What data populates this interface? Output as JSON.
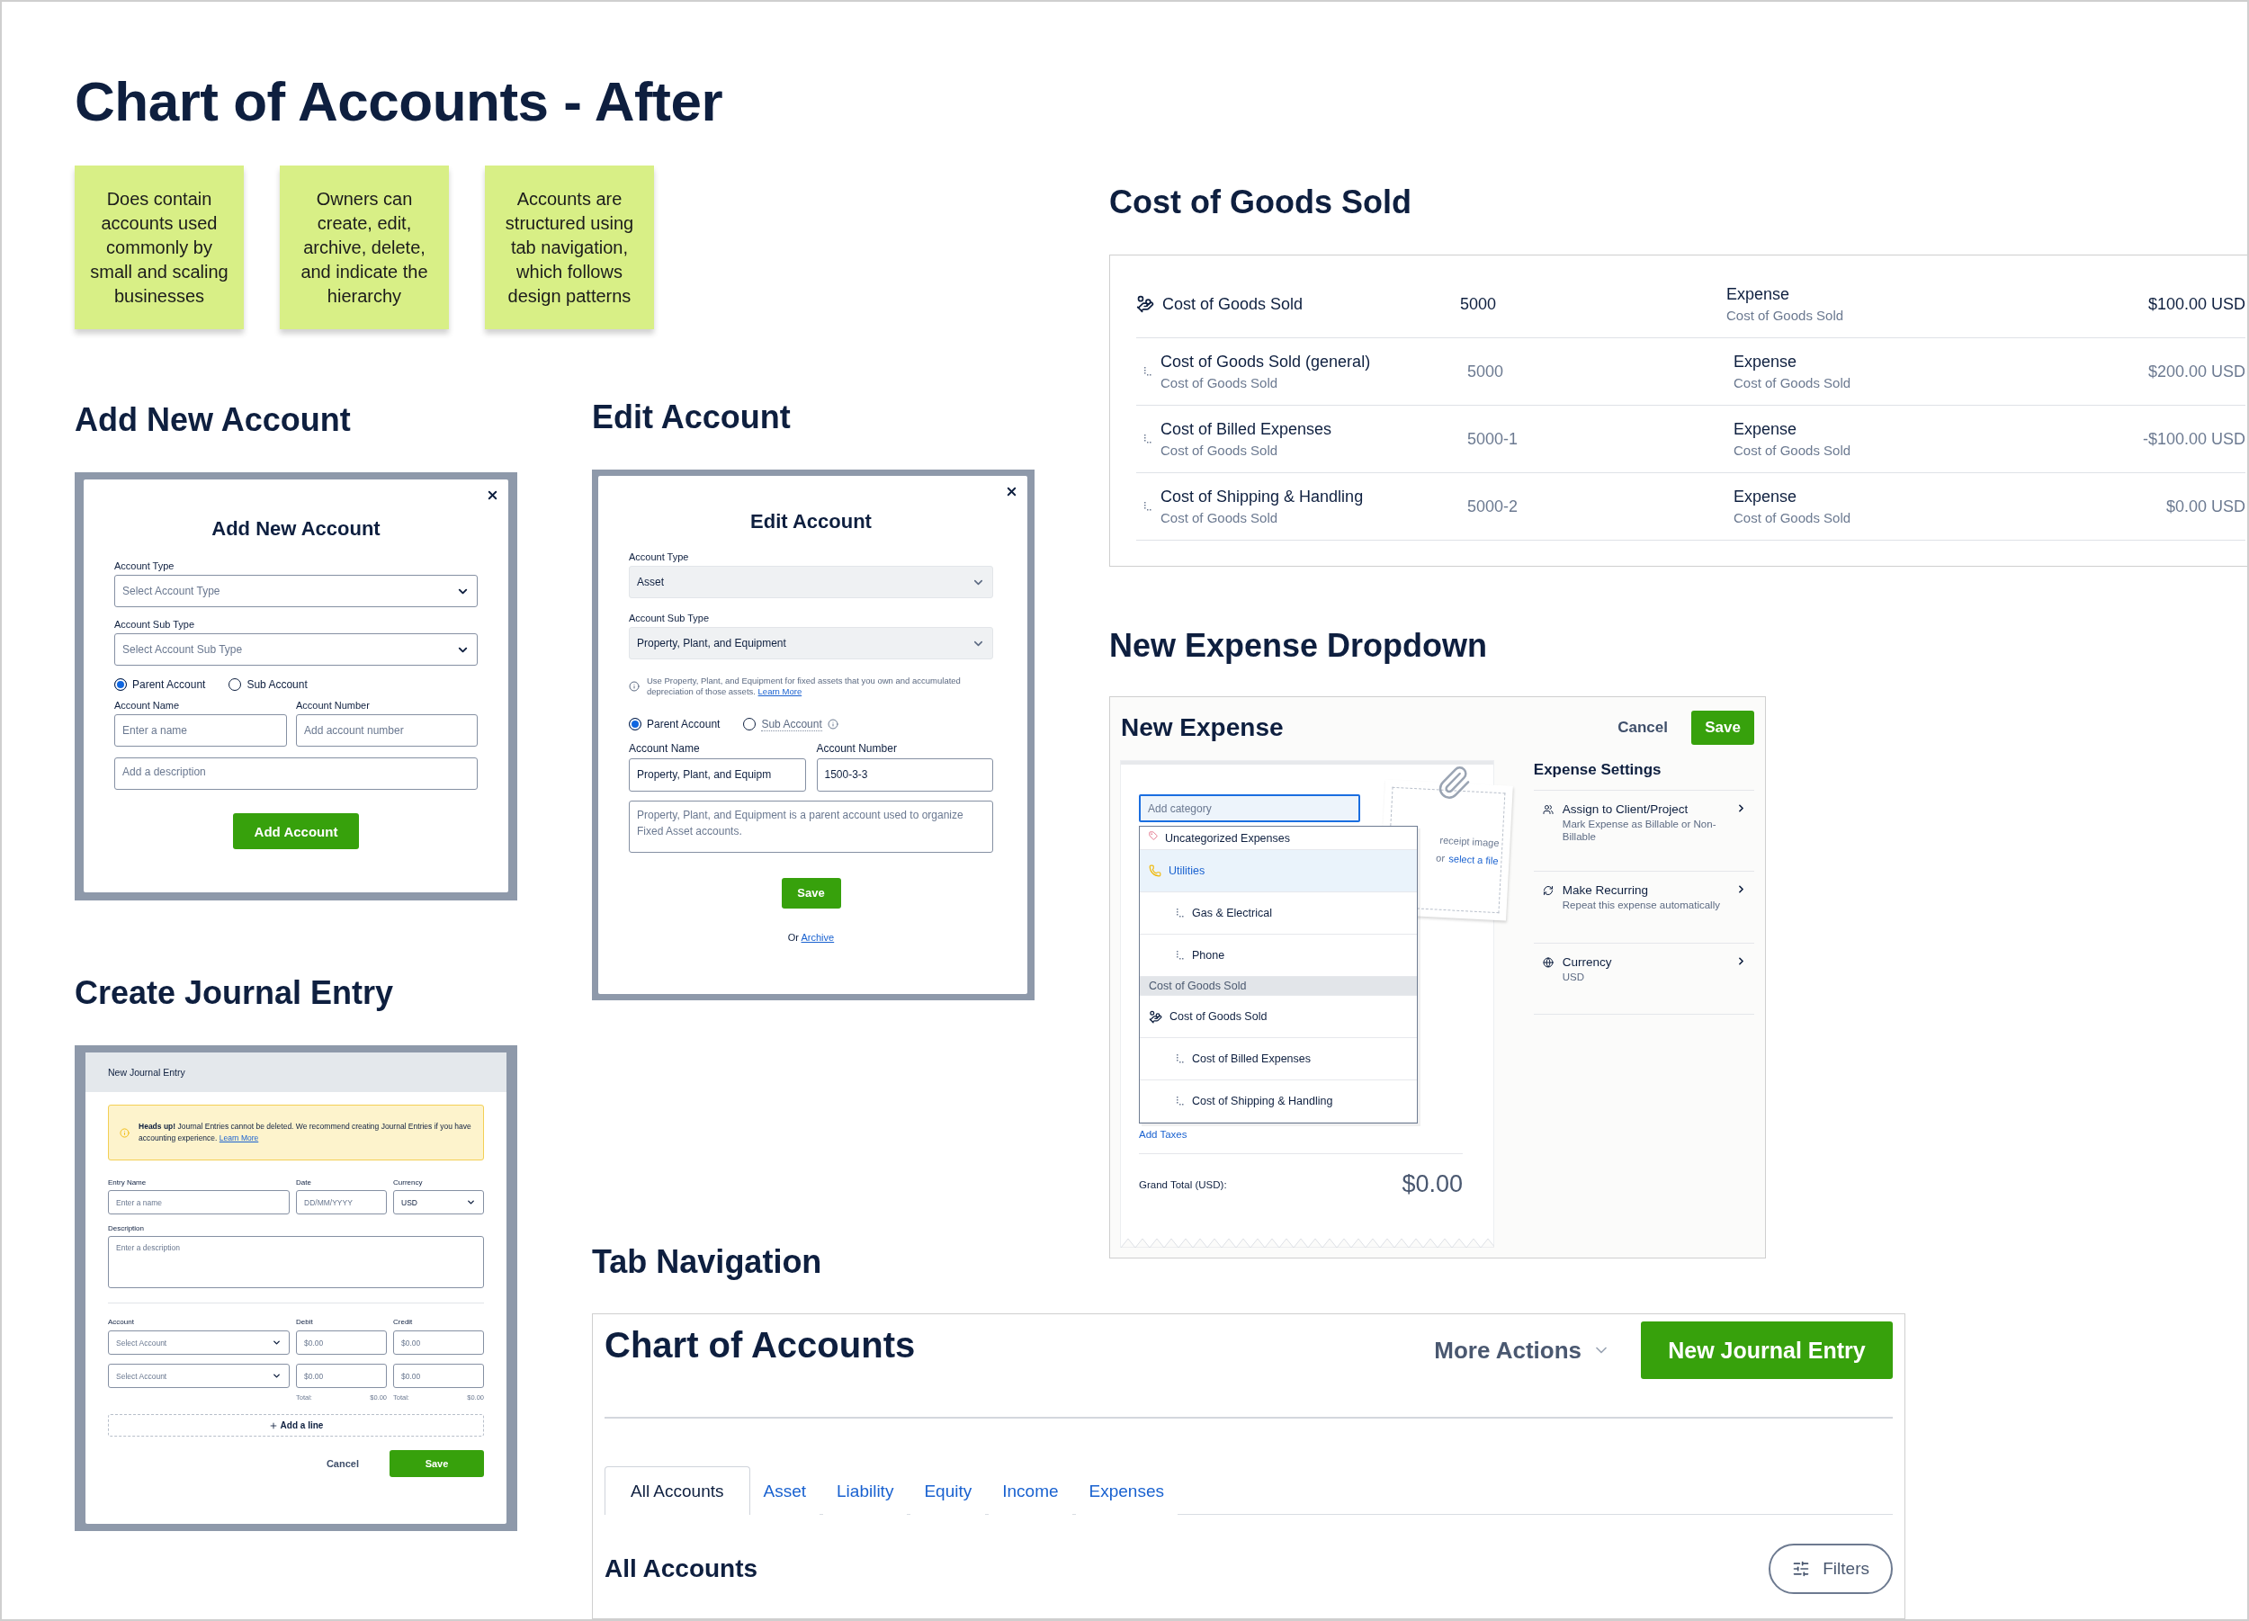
{
  "page": {
    "title": "Chart of Accounts - After"
  },
  "notes": [
    {
      "text": "Does contain accounts used commonly by small and scaling businesses"
    },
    {
      "text": "Owners can create, edit, archive, delete, and indicate the hierarchy"
    },
    {
      "text": "Accounts are structured using tab navigation, which follows design patterns"
    }
  ],
  "add_new_account": {
    "section_title": "Add New Account",
    "dialog_title": "Add New Account",
    "account_type": {
      "label": "Account Type",
      "placeholder": "Select Account Type"
    },
    "account_sub_type": {
      "label": "Account Sub Type",
      "placeholder": "Select Account Sub Type"
    },
    "radios": [
      {
        "label": "Parent Account",
        "selected": true
      },
      {
        "label": "Sub Account",
        "selected": false
      }
    ],
    "account_name": {
      "label": "Account Name",
      "placeholder": "Enter a name"
    },
    "account_number": {
      "label": "Account Number",
      "placeholder": "Add account number"
    },
    "description": {
      "placeholder": "Add a description"
    },
    "submit": "Add Account"
  },
  "edit_account": {
    "section_title": "Edit Account",
    "dialog_title": "Edit Account",
    "account_type": {
      "label": "Account Type",
      "value": "Asset"
    },
    "account_sub_type": {
      "label": "Account Sub Type",
      "value": "Property, Plant, and Equipment"
    },
    "hint": {
      "text": "Use Property, Plant, and Equipment for fixed assets that you own and accumulated depreciation of those assets.",
      "link": "Learn More"
    },
    "radios": [
      {
        "label": "Parent Account",
        "selected": true
      },
      {
        "label": "Sub Account",
        "selected": false
      }
    ],
    "account_name": {
      "label": "Account Name",
      "value": "Property, Plant, and Equipm"
    },
    "account_number": {
      "label": "Account Number",
      "value": "1500-3-3"
    },
    "description": {
      "value": "Property, Plant, and Equipment is a parent account used to organize Fixed Asset accounts."
    },
    "save": "Save",
    "archive": {
      "prefix": "Or",
      "link": "Archive"
    }
  },
  "journal_entry": {
    "section_title": "Create Journal Entry",
    "header": "New Journal Entry",
    "alert": {
      "text": "**Heads up!** Journal Entries cannot be deleted. We recommend creating Journal Entries if you have accounting experience.",
      "link": "Learn More"
    },
    "entry_name": {
      "label": "Entry Name",
      "placeholder": "Enter a name"
    },
    "date": {
      "label": "Date",
      "placeholder": "DD/MM/YYYY"
    },
    "currency": {
      "label": "Currency",
      "value": "USD"
    },
    "description": {
      "label": "Description",
      "placeholder": "Enter a description"
    },
    "columns": [
      "Account",
      "Debit",
      "Credit"
    ],
    "lines": [
      {
        "account": {
          "placeholder": "Select Account"
        },
        "debit": {
          "placeholder": "$0.00"
        },
        "credit": {
          "placeholder": "$0.00"
        }
      },
      {
        "account": {
          "placeholder": "Select Account"
        },
        "debit": {
          "placeholder": "$0.00"
        },
        "credit": {
          "placeholder": "$0.00"
        }
      }
    ],
    "totals": [
      {
        "label": "Total:",
        "value": "$0.00"
      },
      {
        "label": "Total:",
        "value": "$0.00"
      }
    ],
    "add_line": "Add a line",
    "cancel": "Cancel",
    "save": "Save"
  },
  "cost_of_goods_sold": {
    "section_title": "Cost of Goods Sold",
    "rows": [
      {
        "kind": "parent",
        "name": "Cost of Goods Sold",
        "number": "5000",
        "type": "Expense",
        "subtype": "Cost of Goods Sold",
        "balance": "$100.00 USD"
      },
      {
        "kind": "child",
        "name": "Cost of Goods Sold (general)",
        "parent": "Cost of Goods Sold",
        "number": "5000",
        "type": "Expense",
        "subtype": "Cost of Goods Sold",
        "balance": "$200.00 USD"
      },
      {
        "kind": "child",
        "name": "Cost of Billed Expenses",
        "parent": "Cost of Goods Sold",
        "number": "5000-1",
        "type": "Expense",
        "subtype": "Cost of Goods Sold",
        "balance": "-$100.00 USD"
      },
      {
        "kind": "child",
        "name": "Cost of Shipping & Handling",
        "parent": "Cost of Goods Sold",
        "number": "5000-2",
        "type": "Expense",
        "subtype": "Cost of Goods Sold",
        "balance": "$0.00 USD"
      }
    ]
  },
  "new_expense": {
    "section_title": "New Expense Dropdown",
    "title": "New Expense",
    "cancel": "Cancel",
    "save": "Save",
    "category_field": {
      "placeholder": "Add category"
    },
    "dropdown": [
      {
        "kind": "top",
        "label": "Uncategorized Expenses",
        "selected": false
      },
      {
        "kind": "parent",
        "label": "Utilities",
        "selected": true
      },
      {
        "kind": "child",
        "label": "Gas & Electrical",
        "selected": false
      },
      {
        "kind": "child",
        "label": "Phone",
        "selected": false
      },
      {
        "kind": "group",
        "label": "Cost of Goods Sold",
        "selected": false
      },
      {
        "kind": "parent",
        "label": "Cost of Goods Sold",
        "selected": false
      },
      {
        "kind": "child",
        "label": "Cost of Billed Expenses",
        "selected": false
      },
      {
        "kind": "child",
        "label": "Cost of Shipping & Handling",
        "selected": false
      }
    ],
    "receipt": {
      "text": "receipt image",
      "prefix": "or",
      "link": "select a file"
    },
    "add_taxes": "Add Taxes",
    "grand_total": {
      "label": "Grand Total (USD):",
      "value": "$0.00"
    },
    "settings": {
      "title": "Expense Settings",
      "items": [
        {
          "title": "Assign to Client/Project",
          "subtitle": "Mark Expense as Billable or Non-Billable"
        },
        {
          "title": "Make Recurring",
          "subtitle": "Repeat this expense automatically"
        },
        {
          "title": "Currency",
          "subtitle": "USD"
        }
      ]
    }
  },
  "tab_navigation": {
    "section_title": "Tab Navigation",
    "title": "Chart of Accounts",
    "more_actions": "More Actions",
    "primary": "New Journal Entry",
    "tabs": [
      {
        "label": "All Accounts",
        "selected": true
      },
      {
        "label": "Asset",
        "selected": false
      },
      {
        "label": "Liability",
        "selected": false
      },
      {
        "label": "Equity",
        "selected": false
      },
      {
        "label": "Income",
        "selected": false
      },
      {
        "label": "Expenses",
        "selected": false
      }
    ],
    "subtitle": "All Accounts",
    "filters": "Filters"
  }
}
